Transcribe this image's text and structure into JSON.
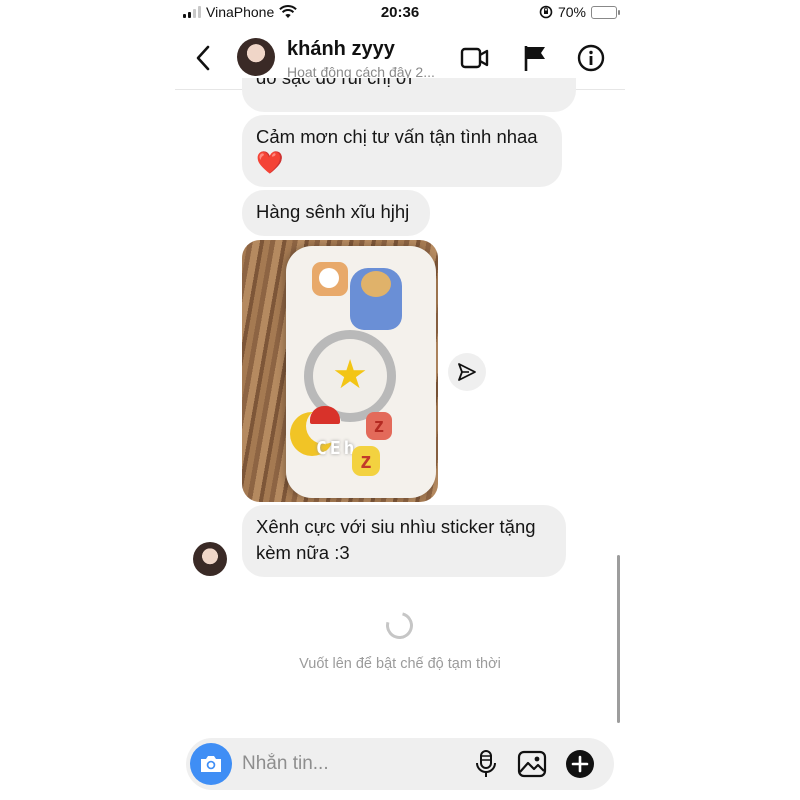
{
  "status_bar": {
    "carrier": "VinaPhone",
    "time": "20:36",
    "battery_percent": "70%",
    "battery_level": 0.7,
    "battery_color": "#f7c613",
    "signal_bars_active": 2,
    "icons": [
      "signal-icon",
      "wifi-icon",
      "orientation-lock-icon",
      "battery-icon"
    ]
  },
  "header": {
    "contact_name": "khánh zyyy",
    "activity_status": "Hoạt động cách đây 2...",
    "icons": [
      "back-chevron-icon",
      "video-call-icon",
      "flag-icon",
      "info-icon"
    ]
  },
  "messages": [
    {
      "type": "text",
      "text": "đó sạc đó rùi chị ơi",
      "clipped": true
    },
    {
      "type": "text",
      "text": "Cảm mơn chị tư vấn tận tình nhaa",
      "emoji": "❤️"
    },
    {
      "type": "text",
      "text": "Hàng sênh xĩu hjhj"
    },
    {
      "type": "image",
      "description_icon": "phone-case-photo",
      "led_text": "CEh"
    },
    {
      "type": "text",
      "text": "Xênh cực với siu nhìu sticker tặng kèm nữa :3"
    }
  ],
  "share_icon": "send-icon",
  "vanish_mode_hint": "Vuốt lên để bật chế độ tạm thời",
  "composer": {
    "placeholder": "Nhắn tin...",
    "camera_button_color": "#3f8ef5",
    "icons": [
      "camera-icon",
      "microphone-icon",
      "gallery-icon",
      "add-icon"
    ]
  }
}
